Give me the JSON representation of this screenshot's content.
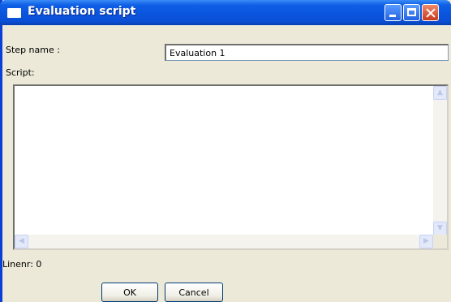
{
  "window": {
    "title": "Evaluation script"
  },
  "form": {
    "step_name_label": "Step name :",
    "step_name_value": "Evaluation 1",
    "script_label": "Script:",
    "script_value": "",
    "linenr_label": "Linenr: 0"
  },
  "buttons": {
    "ok_label": "OK",
    "cancel_label": "Cancel"
  },
  "icons": {
    "window": "window-icon",
    "minimize": "minimize-icon",
    "maximize": "maximize-icon",
    "close": "close-icon",
    "scroll_up": "chevron-up-icon",
    "scroll_down": "chevron-down-icon",
    "scroll_left": "chevron-left-icon",
    "scroll_right": "chevron-right-icon"
  },
  "colors": {
    "titlebar": "#0a55dd",
    "window_bg": "#ece9d8",
    "close_button": "#c8391c"
  }
}
